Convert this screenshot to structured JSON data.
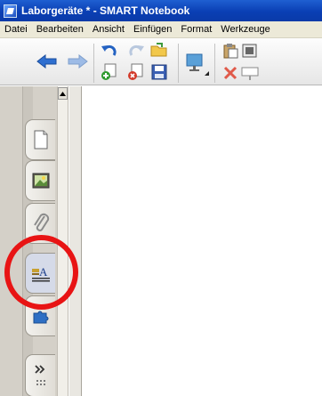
{
  "window": {
    "title": "Laborgeräte * - SMART Notebook"
  },
  "menu": [
    {
      "label": "Datei"
    },
    {
      "label": "Bearbeiten"
    },
    {
      "label": "Ansicht"
    },
    {
      "label": "Einfügen"
    },
    {
      "label": "Format"
    },
    {
      "label": "Werkzeuge"
    }
  ],
  "toolbar": {
    "buttons": [
      "back-arrow-icon",
      "forward-arrow-icon",
      "undo-icon",
      "redo-icon",
      "open-folder-icon",
      "add-page-icon",
      "delete-page-icon",
      "save-icon",
      "display-icon",
      "paste-icon",
      "delete-icon",
      "screen-shade-icon"
    ]
  },
  "sidebar": {
    "tabs": [
      {
        "name": "page-sorter-icon"
      },
      {
        "name": "gallery-icon"
      },
      {
        "name": "attachments-icon"
      },
      {
        "name": "properties-icon",
        "highlighted": true
      },
      {
        "name": "addons-icon"
      }
    ]
  },
  "annotation": {
    "color": "#e81414"
  }
}
